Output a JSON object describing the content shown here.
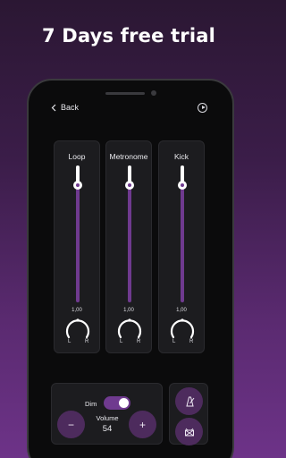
{
  "promo": {
    "title": "7 Days free trial"
  },
  "header": {
    "back_label": "Back"
  },
  "channels": [
    {
      "name": "Loop",
      "pan_value": "1,00",
      "pan_left": "L",
      "pan_right": "R",
      "level": 0.81
    },
    {
      "name": "Metronome",
      "pan_value": "1,00",
      "pan_left": "L",
      "pan_right": "R",
      "level": 0.81
    },
    {
      "name": "Kick",
      "pan_value": "1,00",
      "pan_left": "L",
      "pan_right": "R",
      "level": 0.81
    }
  ],
  "controls": {
    "dim_label": "Dim",
    "dim_on": true,
    "volume_label": "Volume",
    "volume_value": "54",
    "minus_label": "−",
    "plus_label": "+"
  },
  "colors": {
    "accent": "#6f3a8f",
    "button_bg": "#4d2b5d",
    "panel_bg": "#1c1c1f"
  },
  "icons": {
    "back": "chevron-left-icon",
    "play": "play-circle-icon",
    "metronome": "metronome-icon",
    "drum": "drum-icon"
  }
}
